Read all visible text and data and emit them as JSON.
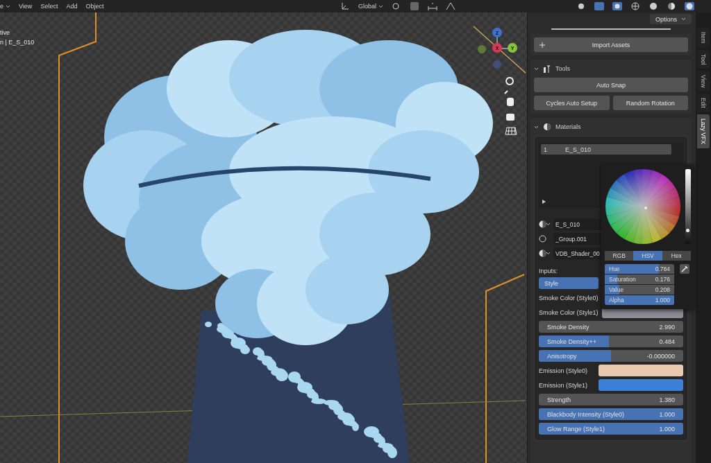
{
  "header": {
    "mode_menu": "e",
    "menus": [
      "View",
      "Select",
      "Add",
      "Object"
    ],
    "orientation": "Global"
  },
  "viewport": {
    "mode_label": "tive",
    "object_label": "n | E_S_010",
    "gizmo_axes": [
      {
        "label": "Z",
        "color": "#3f6fd0"
      },
      {
        "label": "X",
        "color": "#d63a55"
      },
      {
        "label": "Y",
        "color": "#86c53a"
      }
    ]
  },
  "sidebar": {
    "options": "Options",
    "import_button": "Import Assets",
    "tools": {
      "title": "Tools",
      "expanded": true,
      "buttons": [
        "Auto Snap",
        "Cycles Auto Setup",
        "Random Rotation"
      ]
    },
    "materials": {
      "title": "Materials",
      "expanded": true,
      "slots": [
        {
          "index": "1",
          "name": "E_S_010",
          "selected": true
        }
      ],
      "material": "E_S_010",
      "group": "_Group.001",
      "shader": "VDB_Shader_00",
      "inputs_label": "Inputs:",
      "inputs": [
        {
          "kind": "enum",
          "label": "Style"
        },
        {
          "kind": "color",
          "label": "Smoke Color (Style0)"
        },
        {
          "kind": "color",
          "label": "Smoke Color (Style1)",
          "color": "#8e8d96"
        },
        {
          "kind": "number",
          "label": "Smoke Density",
          "value": "2.990"
        },
        {
          "kind": "slider",
          "label": "Smoke Density++",
          "value": "0.484",
          "level": 0.484
        },
        {
          "kind": "slider",
          "label": "Anisotropy",
          "value": "-0.000000",
          "level": 0.5
        },
        {
          "kind": "color",
          "label": "Emission (Style0)",
          "color": "#e8c9ad"
        },
        {
          "kind": "color",
          "label": "Emission (Style1)",
          "color": "#3d7fd6"
        },
        {
          "kind": "number",
          "label": "Strength",
          "value": "1.380"
        },
        {
          "kind": "slider",
          "label": "Blackbody Intensity  (Style0)",
          "value": "1.000",
          "level": 1
        },
        {
          "kind": "slider",
          "label": "Glow Range (Style1)",
          "value": "1.000",
          "level": 1
        }
      ]
    }
  },
  "tabs": [
    {
      "label": "Item",
      "selected": false
    },
    {
      "label": "Tool",
      "selected": false
    },
    {
      "label": "View",
      "selected": false
    },
    {
      "label": "Edit",
      "selected": false
    },
    {
      "label": "Lazy VFX",
      "selected": true
    }
  ],
  "color_picker": {
    "modes": [
      {
        "label": "RGB",
        "selected": false
      },
      {
        "label": "HSV",
        "selected": true
      },
      {
        "label": "Hex",
        "selected": false
      }
    ],
    "fields": [
      {
        "label": "Hue",
        "value": "0.784",
        "level": 0.784
      },
      {
        "label": "Saturation",
        "value": "0.176",
        "level": 0.176
      },
      {
        "label": "Value",
        "value": "0.208",
        "level": 0.208
      },
      {
        "label": "Alpha",
        "value": "1.000",
        "level": 1
      }
    ]
  }
}
